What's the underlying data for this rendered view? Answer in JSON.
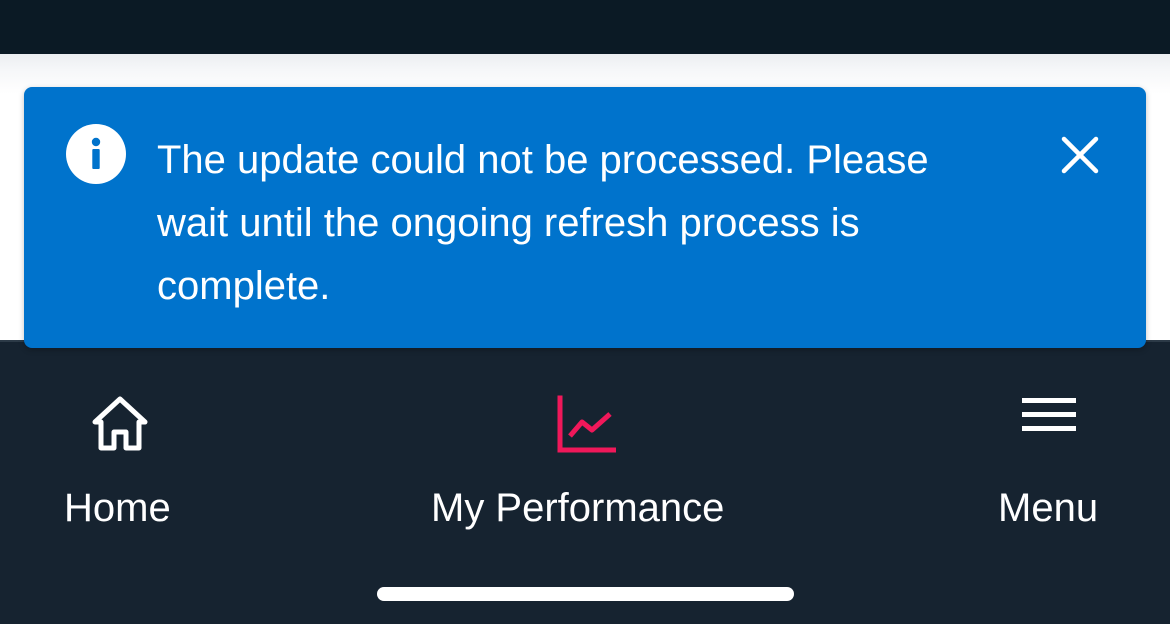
{
  "toast": {
    "message": "The update could not be processed. Please wait until the ongoing refresh process is complete.",
    "info_icon": "info-icon",
    "close_icon": "close-icon",
    "color": "#0073cc"
  },
  "bottom_nav": {
    "items": [
      {
        "label": "Home",
        "icon": "home-icon",
        "active": false
      },
      {
        "label": "My Performance",
        "icon": "chart-line-icon",
        "active": true
      },
      {
        "label": "Menu",
        "icon": "hamburger-menu-icon",
        "active": false
      }
    ],
    "active_icon_color": "#f0185a",
    "background": "#162330"
  }
}
